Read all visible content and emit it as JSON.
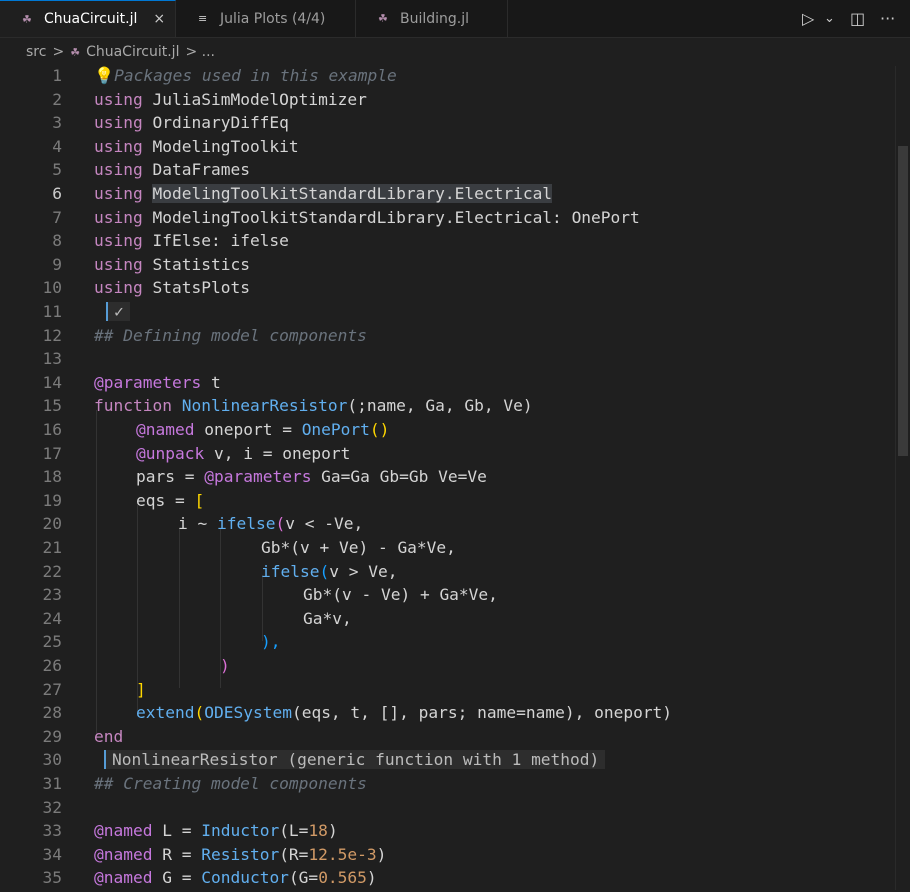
{
  "tabs": [
    {
      "label": "ChuaCircuit.jl",
      "icon": "julia-icon",
      "active": true
    },
    {
      "label": "Julia Plots (4/4)",
      "icon": "list-icon",
      "active": false
    },
    {
      "label": "Building.jl",
      "icon": "julia-icon",
      "active": false
    }
  ],
  "tab_close": "×",
  "toolbar": {
    "run": "▷",
    "run_dropdown": "⌄",
    "split": "◫",
    "more": "···"
  },
  "breadcrumb": {
    "folder": "src",
    "sep": ">",
    "file": "ChuaCircuit.jl",
    "tail": "> ..."
  },
  "lines": [
    {
      "n": "1"
    },
    {
      "n": "2"
    },
    {
      "n": "3"
    },
    {
      "n": "4"
    },
    {
      "n": "5"
    },
    {
      "n": "6"
    },
    {
      "n": "7"
    },
    {
      "n": "8"
    },
    {
      "n": "9"
    },
    {
      "n": "10"
    },
    {
      "n": "11"
    },
    {
      "n": "12"
    },
    {
      "n": "13"
    },
    {
      "n": "14"
    },
    {
      "n": "15"
    },
    {
      "n": "16"
    },
    {
      "n": "17"
    },
    {
      "n": "18"
    },
    {
      "n": "19"
    },
    {
      "n": "20"
    },
    {
      "n": "21"
    },
    {
      "n": "22"
    },
    {
      "n": "23"
    },
    {
      "n": "24"
    },
    {
      "n": "25"
    },
    {
      "n": "26"
    },
    {
      "n": "27"
    },
    {
      "n": "28"
    },
    {
      "n": "29"
    },
    {
      "n": "30"
    },
    {
      "n": "31"
    },
    {
      "n": "32"
    },
    {
      "n": "33"
    },
    {
      "n": "34"
    },
    {
      "n": "35"
    }
  ],
  "code": {
    "l1": "Packages used in this example",
    "l2": "JuliaSimModelOptimizer",
    "l3": "OrdinaryDiffEq",
    "l4": "ModelingToolkit",
    "l5": "DataFrames",
    "l6": "ModelingToolkitStandardLibrary.Electrical",
    "l7a": "ModelingToolkitStandardLibrary.Electrical: ",
    "l7b": "OnePort",
    "l8": "IfElse: ifelse",
    "l9": "Statistics",
    "l10": "StatsPlots",
    "l11": "✓",
    "l12": "## Defining model components",
    "l14a": "@parameters",
    "l14b": " t",
    "l15a": "function ",
    "l15b": "NonlinearResistor",
    "l15c": "(;name, Ga, Gb, Ve)",
    "l16a": "@named",
    "l16b": " oneport = ",
    "l16c": "OnePort",
    "l16d": "()",
    "l17a": "@unpack",
    "l17b": " v, i = oneport",
    "l18a": "pars = ",
    "l18b": "@parameters",
    "l18c": " Ga=Ga Gb=Gb Ve=Ve",
    "l19a": "eqs = ",
    "l19b": "[",
    "l20a": "i ~ ",
    "l20b": "ifelse",
    "l20c": "(",
    "l20d": "v < -Ve,",
    "l21": "Gb*(v + Ve) - Ga*Ve,",
    "l22a": "ifelse",
    "l22b": "(",
    "l22c": "v > Ve,",
    "l23": "Gb*(v - Ve) + Ga*Ve,",
    "l24": "Ga*v,",
    "l25": "),",
    "l26": ")",
    "l27": "]",
    "l28a": "extend",
    "l28b": "(",
    "l28c": "ODESystem",
    "l28d": "(eqs, t, [], pars; name=name)",
    "l28e": ", oneport)",
    "l29": "end",
    "l30": "NonlinearResistor (generic function with 1 method)",
    "l31": "## Creating model components",
    "l33a": "@named",
    "l33b": " L = ",
    "l33c": "Inductor",
    "l33d": "(L=",
    "l33e": "18",
    "l33f": ")",
    "l34a": "@named",
    "l34b": " R = ",
    "l34c": "Resistor",
    "l34d": "(R=",
    "l34e": "12.5e-3",
    "l34f": ")",
    "l35a": "@named",
    "l35b": " G = ",
    "l35c": "Conductor",
    "l35d": "(G=",
    "l35e": "0.565",
    "l35f": ")",
    "using": "using "
  },
  "colors": {
    "accent": "#0078d4",
    "keyword": "#c586c0",
    "function": "#61afef"
  }
}
